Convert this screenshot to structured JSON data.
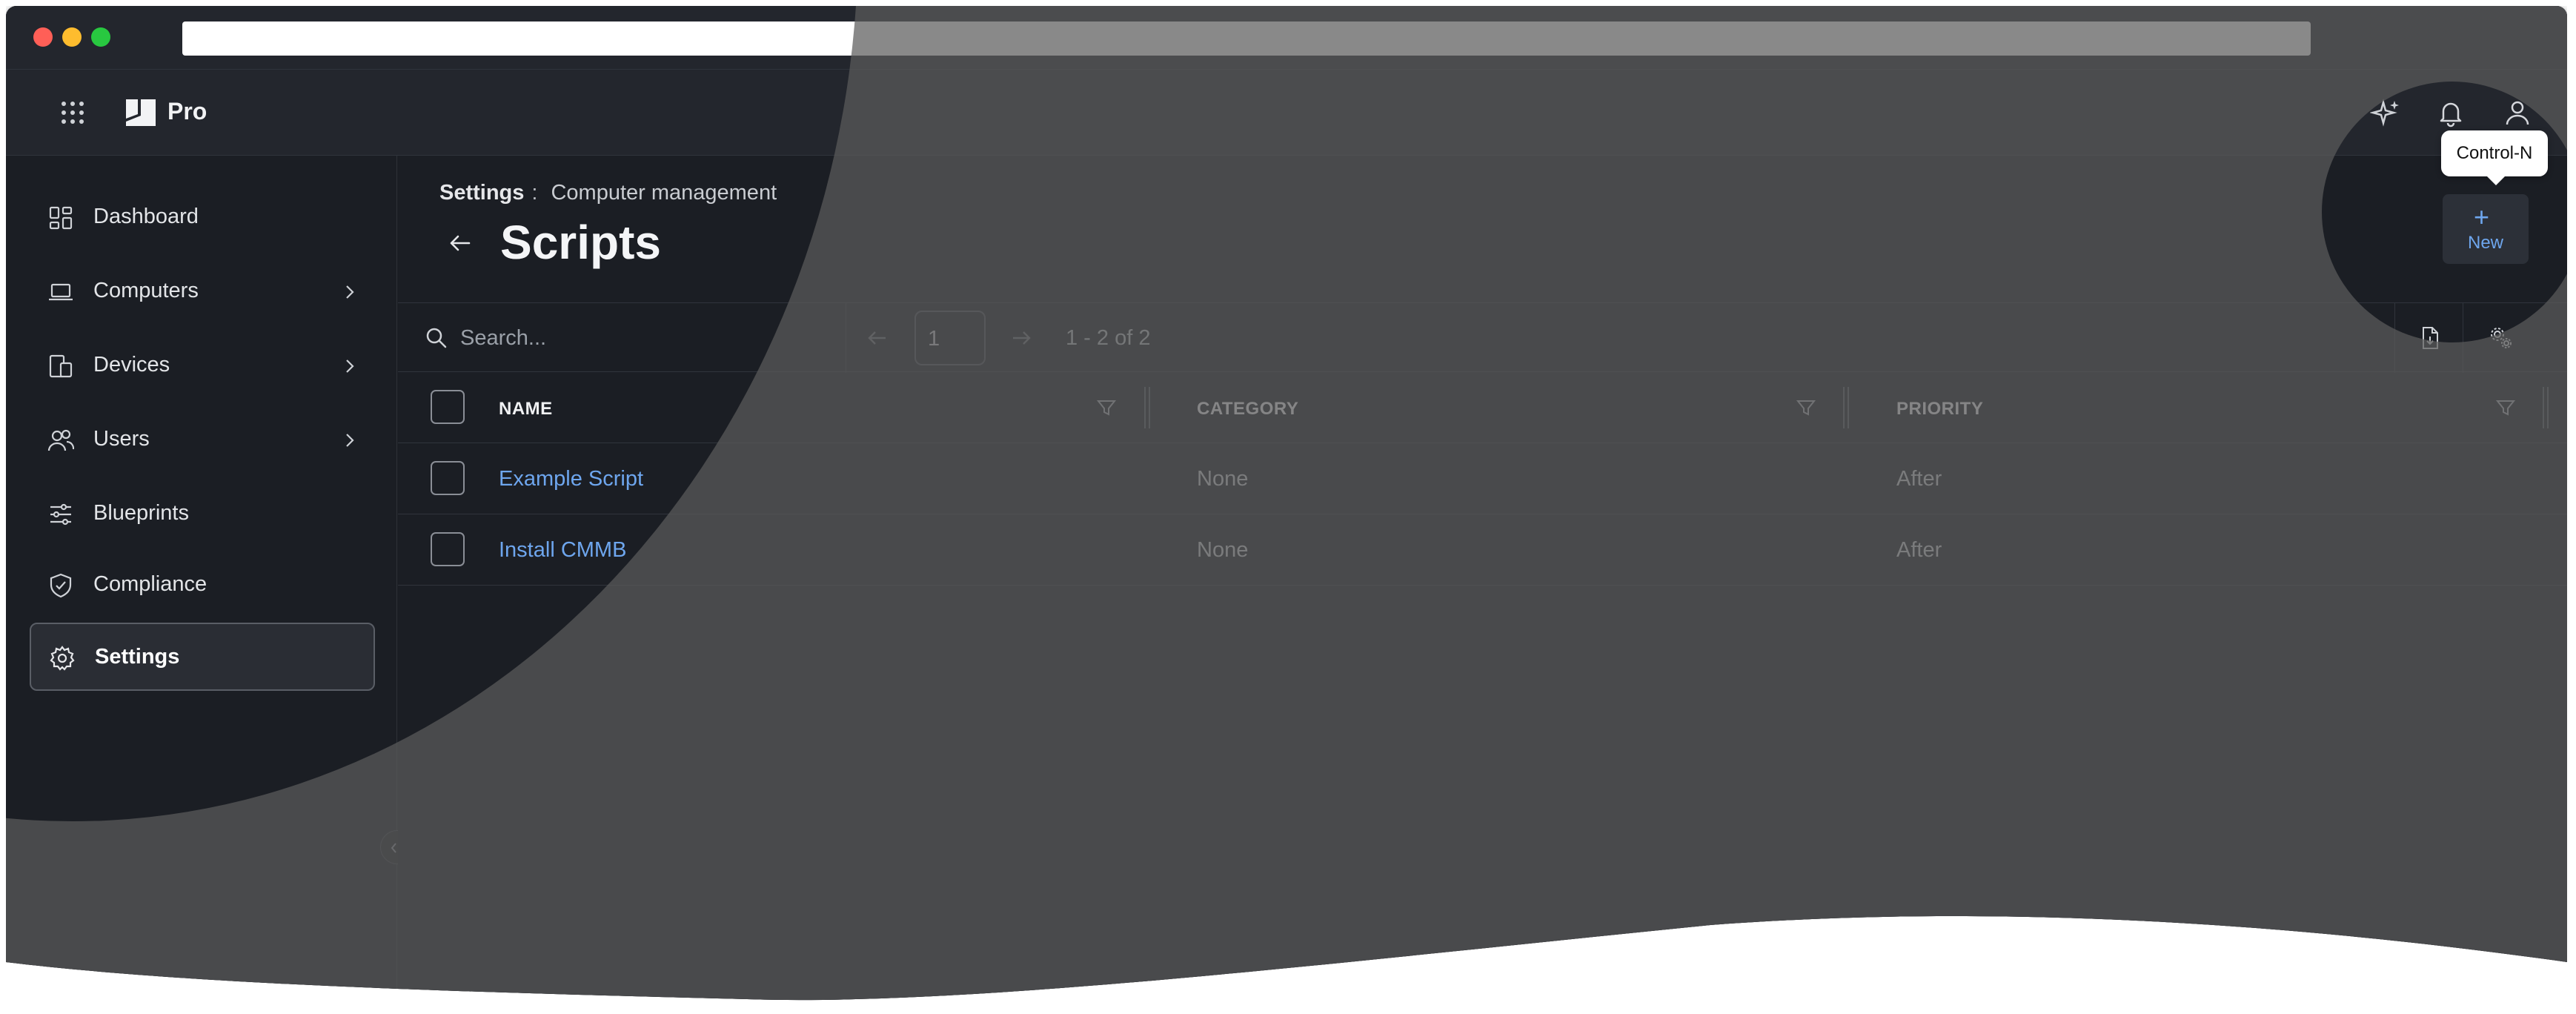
{
  "app": {
    "brand": "Pro"
  },
  "breadcrumb": {
    "parent": "Settings",
    "separator": ":",
    "current": "Computer management"
  },
  "page": {
    "title": "Scripts"
  },
  "sidebar": {
    "items": [
      {
        "label": "Dashboard",
        "icon": "dashboard-icon",
        "has_chevron": false,
        "active": false
      },
      {
        "label": "Computers",
        "icon": "laptop-icon",
        "has_chevron": true,
        "active": false
      },
      {
        "label": "Devices",
        "icon": "devices-icon",
        "has_chevron": true,
        "active": false
      },
      {
        "label": "Users",
        "icon": "users-icon",
        "has_chevron": true,
        "active": false
      },
      {
        "label": "Blueprints",
        "icon": "sliders-icon",
        "has_chevron": false,
        "active": false
      },
      {
        "label": "Compliance",
        "icon": "shield-check-icon",
        "has_chevron": false,
        "active": false
      },
      {
        "label": "Settings",
        "icon": "gear-icon",
        "has_chevron": false,
        "active": true
      }
    ]
  },
  "toolbar": {
    "search_placeholder": "Search...",
    "page_number": "1",
    "page_info": "1 - 2 of 2",
    "new_label": "New",
    "new_tooltip": "Control-N"
  },
  "table": {
    "columns": [
      "NAME",
      "CATEGORY",
      "PRIORITY"
    ],
    "rows": [
      {
        "name": "Example Script",
        "category": "None",
        "priority": "After"
      },
      {
        "name": "Install CMMB",
        "category": "None",
        "priority": "After"
      }
    ]
  },
  "colors": {
    "background": "#1b1e24",
    "link": "#6ea6ee",
    "dim_overlay": "rgba(90,90,90,0.72)"
  }
}
